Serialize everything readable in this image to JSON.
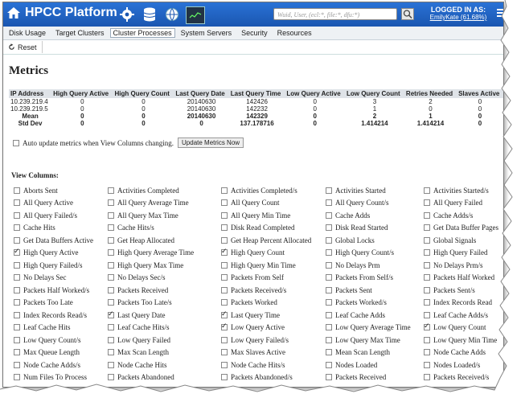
{
  "header": {
    "app_title": "HPCC Platform",
    "search_placeholder": "Wuid, User, (ecl:*, file:*, dfu:*)",
    "logged_in_label": "LOGGED IN AS:",
    "user": "EmilyKate (61.68%)"
  },
  "menu": [
    "Disk Usage",
    "Target Clusters",
    "Cluster Processes",
    "System Servers",
    "Security",
    "Resources"
  ],
  "active_menu": "Cluster Processes",
  "toolbar": {
    "reset_label": "Reset"
  },
  "page_title": "Metrics",
  "metrics_table": {
    "headers": [
      "IP Address",
      "High Query Active",
      "High Query Count",
      "Last Query Date",
      "Last Query Time",
      "Low Query Active",
      "Low Query Count",
      "Retries Needed",
      "Slaves Active"
    ],
    "rows": [
      [
        "10.239.219.4",
        "0",
        "0",
        "20140630",
        "142426",
        "0",
        "3",
        "2",
        "0"
      ],
      [
        "10.239.219.5",
        "0",
        "0",
        "20140630",
        "142232",
        "0",
        "1",
        "0",
        "0"
      ],
      [
        "Mean",
        "0",
        "0",
        "20140630",
        "142329",
        "0",
        "2",
        "1",
        "0"
      ],
      [
        "Std Dev",
        "0",
        "0",
        "0",
        "137.178716",
        "0",
        "1.414214",
        "1.414214",
        "0"
      ]
    ]
  },
  "auto_update_label": "Auto update metrics when View Columns changing.",
  "update_button": "Update Metrics Now",
  "view_columns_label": "View Columns:",
  "columns": [
    {
      "label": "Aborts Sent",
      "checked": false
    },
    {
      "label": "Activities Completed",
      "checked": false
    },
    {
      "label": "Activities Completed/s",
      "checked": false
    },
    {
      "label": "Activities Started",
      "checked": false
    },
    {
      "label": "Activities Started/s",
      "checked": false
    },
    {
      "label": "All Query Active",
      "checked": false
    },
    {
      "label": "All Query Average Time",
      "checked": false
    },
    {
      "label": "All Query Count",
      "checked": false
    },
    {
      "label": "All Query Count/s",
      "checked": false
    },
    {
      "label": "All Query Failed",
      "checked": false
    },
    {
      "label": "All Query Failed/s",
      "checked": false
    },
    {
      "label": "All Query Max Time",
      "checked": false
    },
    {
      "label": "All Query Min Time",
      "checked": false
    },
    {
      "label": "Cache Adds",
      "checked": false
    },
    {
      "label": "Cache Adds/s",
      "checked": false
    },
    {
      "label": "Cache Hits",
      "checked": false
    },
    {
      "label": "Cache Hits/s",
      "checked": false
    },
    {
      "label": "Disk Read Completed",
      "checked": false
    },
    {
      "label": "Disk Read Started",
      "checked": false
    },
    {
      "label": "Get Data Buffer Pages",
      "checked": false
    },
    {
      "label": "Get Data Buffers Active",
      "checked": false
    },
    {
      "label": "Get Heap Allocated",
      "checked": false
    },
    {
      "label": "Get Heap Percent Allocated",
      "checked": false
    },
    {
      "label": "Global Locks",
      "checked": false
    },
    {
      "label": "Global Signals",
      "checked": false
    },
    {
      "label": "High Query Active",
      "checked": true
    },
    {
      "label": "High Query Average Time",
      "checked": false
    },
    {
      "label": "High Query Count",
      "checked": true
    },
    {
      "label": "High Query Count/s",
      "checked": false
    },
    {
      "label": "High Query Failed",
      "checked": false
    },
    {
      "label": "High Query Failed/s",
      "checked": false
    },
    {
      "label": "High Query Max Time",
      "checked": false
    },
    {
      "label": "High Query Min Time",
      "checked": false
    },
    {
      "label": "No Delays Prm",
      "checked": false
    },
    {
      "label": "No Delays Prm/s",
      "checked": false
    },
    {
      "label": "No Delays Sec",
      "checked": false
    },
    {
      "label": "No Delays Sec/s",
      "checked": false
    },
    {
      "label": "Packets From Self",
      "checked": false
    },
    {
      "label": "Packets From Self/s",
      "checked": false
    },
    {
      "label": "Packets Half Worked",
      "checked": false
    },
    {
      "label": "Packets Half Worked/s",
      "checked": false
    },
    {
      "label": "Packets Received",
      "checked": false
    },
    {
      "label": "Packets Received/s",
      "checked": false
    },
    {
      "label": "Packets Sent",
      "checked": false
    },
    {
      "label": "Packets Sent/s",
      "checked": false
    },
    {
      "label": "Packets Too Late",
      "checked": false
    },
    {
      "label": "Packets Too Late/s",
      "checked": false
    },
    {
      "label": "Packets Worked",
      "checked": false
    },
    {
      "label": "Packets Worked/s",
      "checked": false
    },
    {
      "label": "Index Records Read",
      "checked": false
    },
    {
      "label": "Index Records Read/s",
      "checked": false
    },
    {
      "label": "Last Query Date",
      "checked": true
    },
    {
      "label": "Last Query Time",
      "checked": true
    },
    {
      "label": "Leaf Cache Adds",
      "checked": false
    },
    {
      "label": "Leaf Cache Adds/s",
      "checked": false
    },
    {
      "label": "Leaf Cache Hits",
      "checked": false
    },
    {
      "label": "Leaf Cache Hits/s",
      "checked": false
    },
    {
      "label": "Low Query Active",
      "checked": true
    },
    {
      "label": "Low Query Average Time",
      "checked": false
    },
    {
      "label": "Low Query Count",
      "checked": true
    },
    {
      "label": "Low Query Count/s",
      "checked": false
    },
    {
      "label": "Low Query Failed",
      "checked": false
    },
    {
      "label": "Low Query Failed/s",
      "checked": false
    },
    {
      "label": "Low Query Max Time",
      "checked": false
    },
    {
      "label": "Low Query Min Time",
      "checked": false
    },
    {
      "label": "Max Queue Length",
      "checked": false
    },
    {
      "label": "Max Scan Length",
      "checked": false
    },
    {
      "label": "Max Slaves Active",
      "checked": false
    },
    {
      "label": "Mean Scan Length",
      "checked": false
    },
    {
      "label": "Node Cache Adds",
      "checked": false
    },
    {
      "label": "Node Cache Adds/s",
      "checked": false
    },
    {
      "label": "Node Cache Hits",
      "checked": false
    },
    {
      "label": "Node Cache Hits/s",
      "checked": false
    },
    {
      "label": "Nodes Loaded",
      "checked": false
    },
    {
      "label": "Nodes Loaded/s",
      "checked": false
    },
    {
      "label": "Num Files To Process",
      "checked": false
    },
    {
      "label": "Packets Abandoned",
      "checked": false
    },
    {
      "label": "Packets Abandoned/s",
      "checked": false
    },
    {
      "label": "Packets Received",
      "checked": false
    },
    {
      "label": "Packets Received/s",
      "checked": false
    }
  ],
  "colors": {
    "header_blue": "#1e62c0",
    "table_header": "#dfe3e8"
  }
}
